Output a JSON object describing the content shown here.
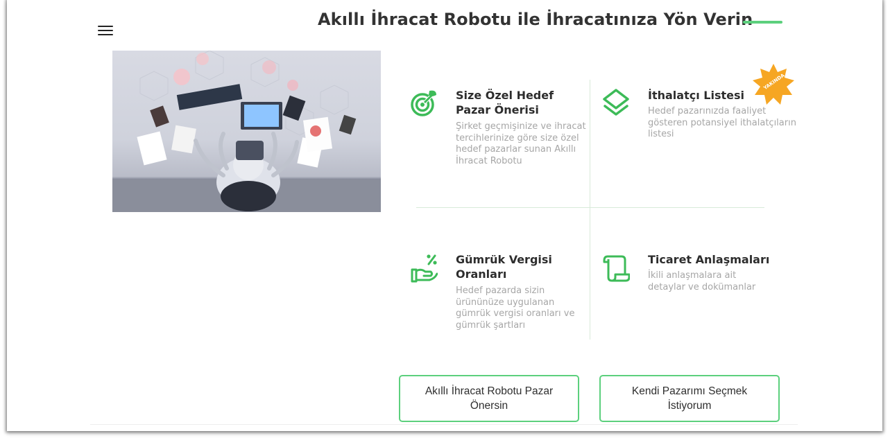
{
  "header": {
    "title": "Akıllı İhracat Robotu ile İhracatınıza Yön Verin",
    "menu_icon": "hamburger-menu-icon"
  },
  "hero_image": {
    "alt": "robot working with multiple devices illustration"
  },
  "features": [
    {
      "icon": "target-leaf-icon",
      "title": "Size Özel Hedef Pazar Önerisi",
      "description": "Şirket geçmişinize ve ihracat tercihlerinize göre size özel hedef pazarlar sunan Akıllı İhracat Robotu"
    },
    {
      "icon": "layers-icon",
      "title": "İthalatçı Listesi",
      "description": "Hedef pazarınızda faaliyet gösteren potansiyel ithalatçıların listesi",
      "badge": "YAKINDA"
    },
    {
      "icon": "hand-percent-icon",
      "title": "Gümrük Vergisi Oranları",
      "description": "Hedef pazarda sizin ürününüze uygulanan gümrük vergisi oranları ve gümrük şartları"
    },
    {
      "icon": "scroll-document-icon",
      "title": "Ticaret Anlaşmaları",
      "description": "İkili anlaşmalara ait detaylar ve dokümanlar"
    }
  ],
  "actions": {
    "robot_suggest": "Akıllı İhracat Robotu Pazar Önersin",
    "choose_own": "Kendi Pazarımı Seçmek İstiyorum"
  },
  "colors": {
    "accent": "#5cd07d",
    "icon_green": "#3dbb58",
    "badge": "#f6a623",
    "title": "#333333",
    "muted": "#a6a6a6"
  }
}
